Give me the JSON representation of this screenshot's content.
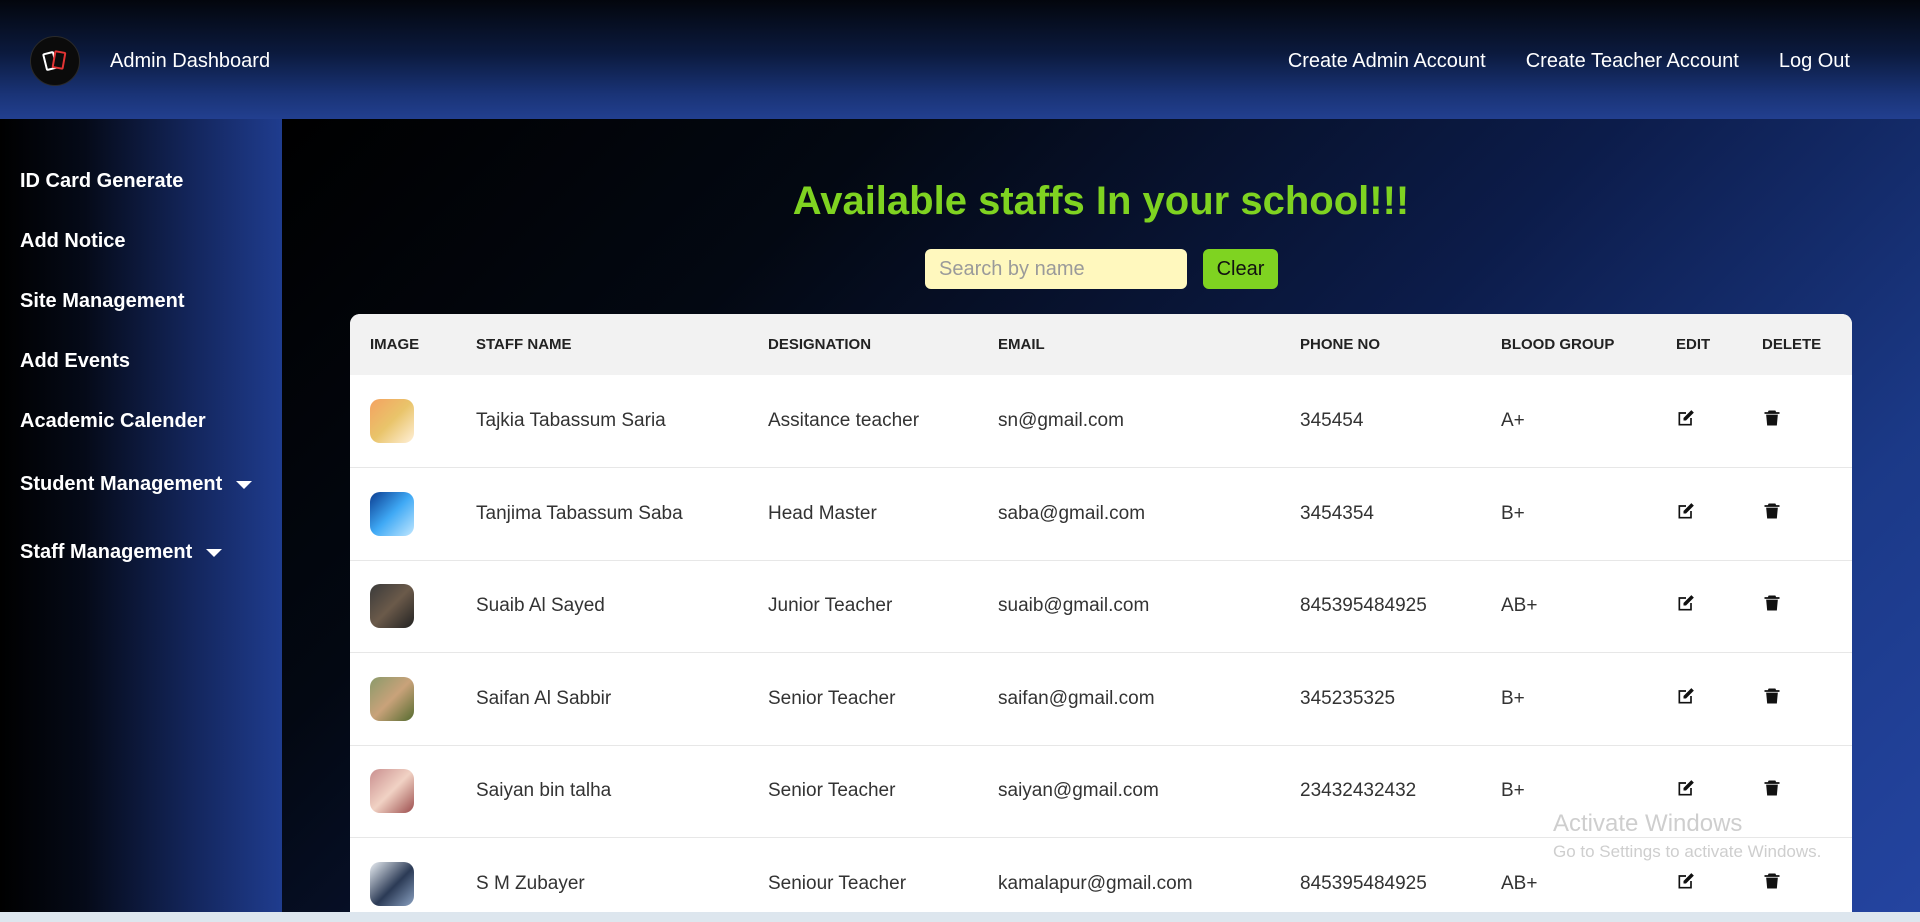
{
  "header": {
    "brand": "Admin Dashboard",
    "nav": [
      "Create Admin Account",
      "Create Teacher Account",
      "Log Out"
    ]
  },
  "sidebar": {
    "items": [
      {
        "label": "ID Card Generate"
      },
      {
        "label": "Add Notice"
      },
      {
        "label": "Site Management"
      },
      {
        "label": "Add Events"
      },
      {
        "label": "Academic Calender"
      },
      {
        "label": "Student Management"
      },
      {
        "label": "Staff Management"
      }
    ]
  },
  "main": {
    "heading": "Available staffs In your school!!!",
    "search_placeholder": "Search by name",
    "clear_label": "Clear",
    "columns": [
      "IMAGE",
      "STAFF NAME",
      "DESIGNATION",
      "EMAIL",
      "PHONE NO",
      "BLOOD GROUP",
      "EDIT",
      "DELETE"
    ],
    "rows": [
      {
        "name": "Tajkia Tabassum Saria",
        "designation": "Assitance teacher",
        "email": "sn@gmail.com",
        "phone": "345454",
        "blood": "A+"
      },
      {
        "name": "Tanjima Tabassum Saba",
        "designation": "Head Master",
        "email": "saba@gmail.com",
        "phone": "3454354",
        "blood": "B+"
      },
      {
        "name": "Suaib Al Sayed",
        "designation": "Junior Teacher",
        "email": "suaib@gmail.com",
        "phone": "845395484925",
        "blood": "AB+"
      },
      {
        "name": "Saifan Al Sabbir",
        "designation": "Senior Teacher",
        "email": "saifan@gmail.com",
        "phone": "345235325",
        "blood": "B+"
      },
      {
        "name": "Saiyan bin talha",
        "designation": "Senior Teacher",
        "email": "saiyan@gmail.com",
        "phone": "23432432432",
        "blood": "B+"
      },
      {
        "name": "S M Zubayer",
        "designation": "Seniour Teacher",
        "email": "kamalapur@gmail.com",
        "phone": "845395484925",
        "blood": "AB+"
      }
    ]
  },
  "watermark": {
    "line1": "Activate Windows",
    "line2": "Go to Settings to activate Windows."
  },
  "colors": {
    "accent_green": "#7fd321",
    "search_bg": "#fff8be",
    "header_blue": "#223f8f"
  }
}
